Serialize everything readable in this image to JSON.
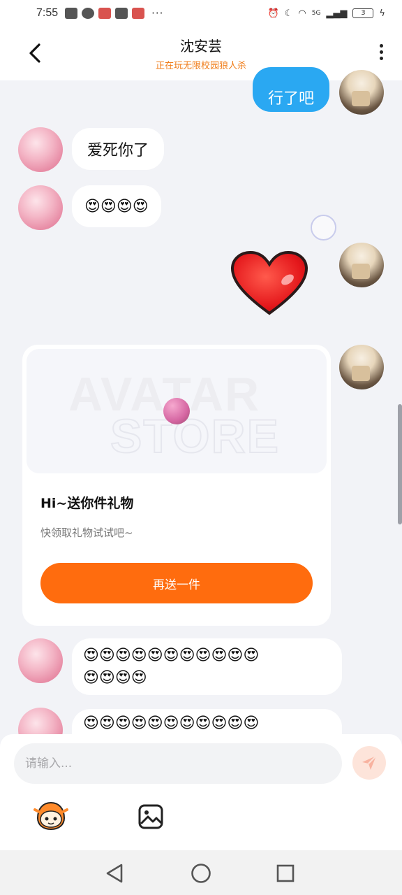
{
  "status_bar": {
    "time": "7:55",
    "more": "···",
    "network": "5G",
    "battery": "3"
  },
  "header": {
    "back_icon": "chevron-left-icon",
    "title": "沈安芸",
    "subtitle": "正在玩无限校园狼人杀",
    "menu_icon": "more-vertical-icon"
  },
  "messages": [
    {
      "from": "me",
      "type": "text",
      "text": "行了吧"
    },
    {
      "from": "other",
      "type": "text",
      "text": "爱死你了"
    },
    {
      "from": "other",
      "type": "emoji",
      "text": "😍😍😍😍"
    },
    {
      "from": "me",
      "type": "sticker",
      "icon": "heart-icon"
    },
    {
      "from": "me",
      "type": "gift-card",
      "watermark_line1": "AVATAR",
      "watermark_line2": "STORE",
      "title": "Hi~送你件礼物",
      "description": "快领取礼物试试吧~",
      "button_label": "再送一件"
    },
    {
      "from": "other",
      "type": "emoji",
      "text": "😍😍😍😍😍😍😍😍😍😍😍\n😍😍😍😍"
    },
    {
      "from": "other",
      "type": "emoji",
      "text": "😍😍😍😍😍😍😍😍😍😍😍"
    }
  ],
  "input": {
    "placeholder": "请输入...",
    "send_icon": "send-icon",
    "tools": [
      {
        "icon": "mascot-icon"
      },
      {
        "icon": "image-icon"
      }
    ]
  },
  "colors": {
    "accent_orange": "#ff6c0e",
    "bubble_blue": "#2aa8f2",
    "subtitle_orange": "#f07d1a",
    "background": "#f2f3f7"
  },
  "nav": {
    "icons": [
      "back-triangle-icon",
      "home-circle-icon",
      "recents-square-icon"
    ]
  }
}
